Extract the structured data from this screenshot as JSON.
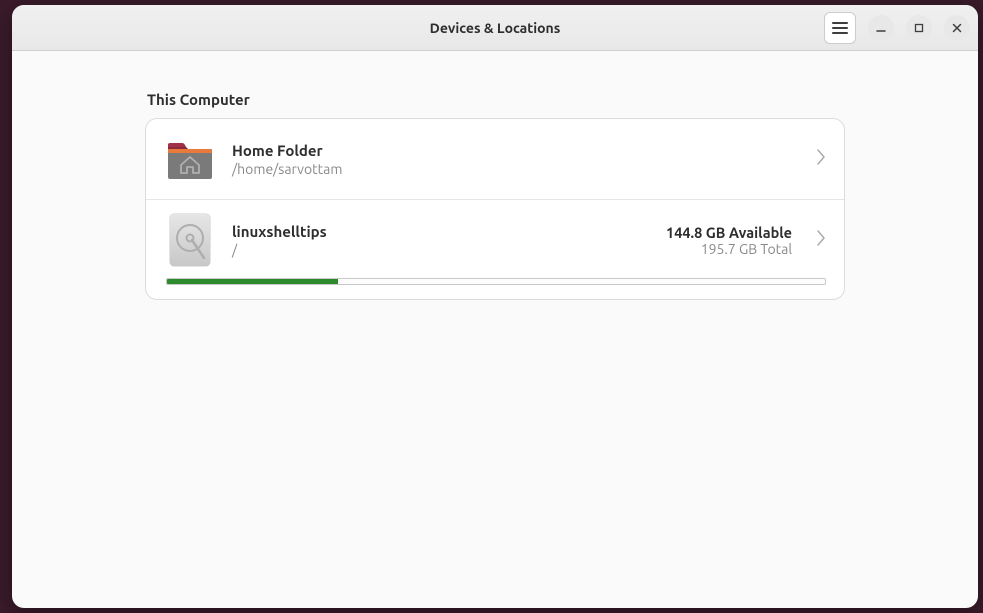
{
  "header": {
    "title": "Devices & Locations"
  },
  "section": {
    "title": "This Computer"
  },
  "home": {
    "title": "Home Folder",
    "path": "/home/sarvottam"
  },
  "disk": {
    "title": "linuxshelltips",
    "mount": "/",
    "available": "144.8 GB Available",
    "total": "195.7 GB Total",
    "used_fraction": 0.26
  }
}
